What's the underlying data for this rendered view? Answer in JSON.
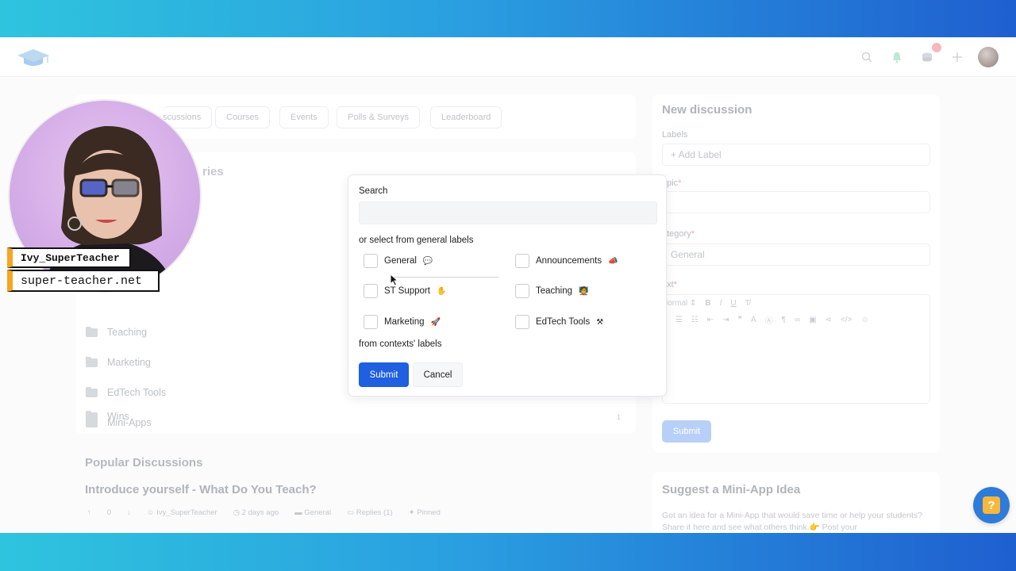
{
  "tabs": [
    "Discussions",
    "Courses",
    "Events",
    "Polls & Surveys",
    "Leaderboard"
  ],
  "tab_visible_first": "scussions",
  "categories_title_visible": "ries",
  "categories": [
    {
      "label": "Teaching"
    },
    {
      "label": "Marketing"
    },
    {
      "label": "EdTech Tools"
    },
    {
      "label": "Mini-Apps"
    },
    {
      "label": "Wins",
      "count": "1"
    }
  ],
  "popular": {
    "title": "Popular Discussions",
    "discussion_title": "Introduce yourself - What Do You Teach?",
    "votes": "0",
    "author": "Ivy_SuperTeacher",
    "time": "2 days ago",
    "category": "General",
    "replies": "Replies (1)",
    "pinned": "Pinned"
  },
  "new_discussion": {
    "title": "New discussion",
    "labels_label": "Labels",
    "add_label": "+ Add Label",
    "topic_label": "opic",
    "category_label": "ategory",
    "category_value": "General",
    "text_label": "ext",
    "format_select": "Normal",
    "submit": "Submit"
  },
  "mini_app": {
    "title": "Suggest a Mini-App Idea",
    "text": "Got an idea for a Mini-App that would save time or help your students? Share it here and see what others think.👉 Post your"
  },
  "webcam": {
    "name": "Ivy_SuperTeacher",
    "site": "super-teacher.net"
  },
  "modal": {
    "search_label": "Search",
    "search_placeholder": "",
    "general_heading": "or select from general labels",
    "options": [
      {
        "label": "General",
        "emoji": "💬",
        "checked": false
      },
      {
        "label": "Announcements",
        "emoji": "📣",
        "checked": false
      },
      {
        "label": "ST Support",
        "emoji": "✋",
        "checked": false
      },
      {
        "label": "Teaching",
        "emoji": "🧑‍🏫",
        "checked": false
      },
      {
        "label": "Marketing",
        "emoji": "🚀",
        "checked": false
      },
      {
        "label": "EdTech Tools",
        "emoji": "⚒",
        "checked": false
      }
    ],
    "contexts_heading": "from contexts' labels",
    "submit": "Submit",
    "cancel": "Cancel"
  },
  "colors": {
    "primary": "#1f5fe0",
    "band_start": "#2ec4de",
    "band_end": "#1f5fd0",
    "help_accent": "#f6b73c",
    "name_tag_accent": "#f5a623"
  },
  "help_icon": "question-icon"
}
